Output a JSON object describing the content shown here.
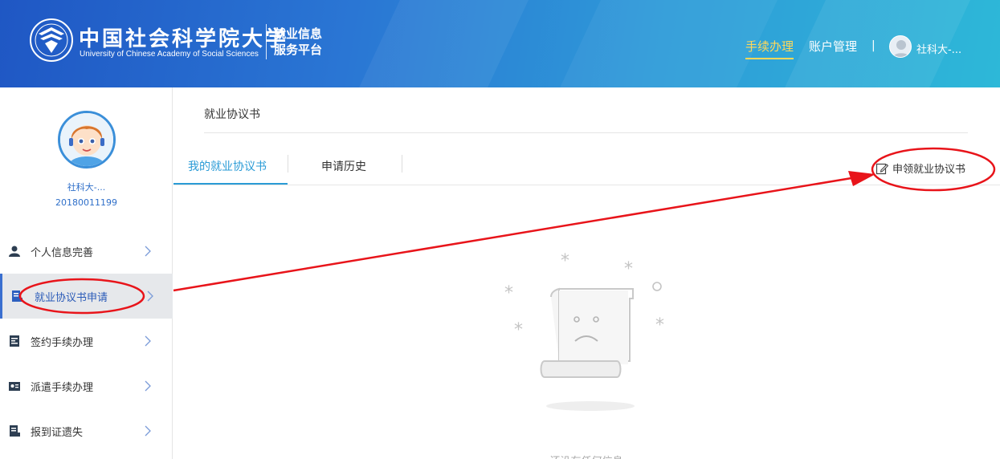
{
  "header": {
    "logo_cn": "中国社会科学院大学",
    "logo_en": "University of Chinese Academy of Social Sciences",
    "platform_line1": "就业信息",
    "platform_line2": "服务平台",
    "nav": {
      "item1": "手续办理",
      "item2": "账户管理",
      "divider": "|"
    },
    "user_name": "社科大-..."
  },
  "sidebar": {
    "user_name": "社科大-...",
    "user_id": "20180011199",
    "items": [
      {
        "label": "个人信息完善",
        "icon": "user-icon"
      },
      {
        "label": "就业协议书申请",
        "icon": "document-icon"
      },
      {
        "label": "签约手续办理",
        "icon": "contract-icon"
      },
      {
        "label": "派遣手续办理",
        "icon": "id-card-icon"
      },
      {
        "label": "报到证遗失",
        "icon": "report-icon"
      }
    ]
  },
  "main": {
    "title": "就业协议书",
    "tabs": [
      {
        "label": "我的就业协议书"
      },
      {
        "label": "申请历史"
      }
    ],
    "apply_button": "申领就业协议书",
    "empty_text": "还没有任何信息"
  },
  "colors": {
    "accent": "#2a9bd6",
    "nav_active": "#ffd85a",
    "annotation": "#e8141a"
  }
}
